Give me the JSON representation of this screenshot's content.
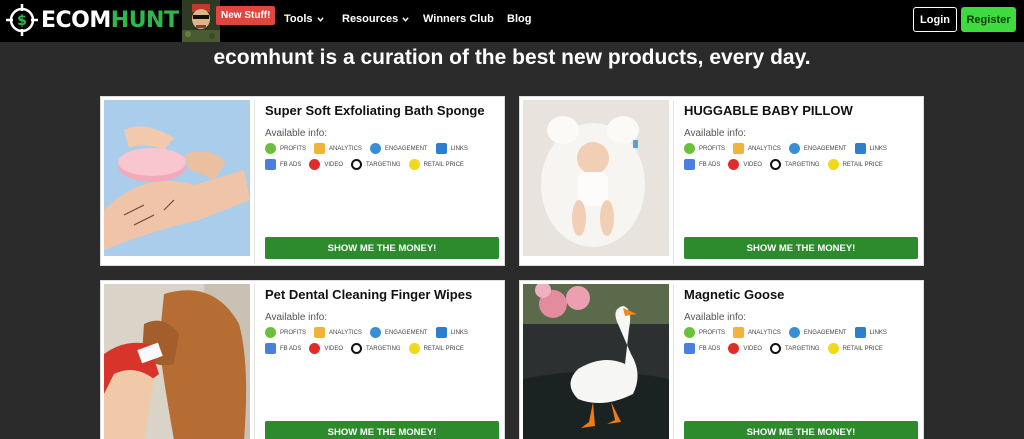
{
  "nav": {
    "logo_left": "ECOM",
    "logo_right": "HUNT",
    "new_badge": "New Stuff!",
    "tools": "Tools",
    "resources": "Resources",
    "winners": "Winners Club",
    "blog": "Blog",
    "login": "Login",
    "register": "Register"
  },
  "headline": "ecomhunt is a curation of the best new products, every day.",
  "common": {
    "available": "Available info:",
    "profits": "PROFITS",
    "analytics": "ANALYTICS",
    "engagement": "ENGAGEMENT",
    "links": "LINKS",
    "fbads": "FB ADS",
    "video": "VIDEO",
    "targeting": "TARGETING",
    "retail": "RETAIL PRICE",
    "button": "SHOW ME THE MONEY!"
  },
  "products": [
    {
      "title": "Super Soft Exfoliating Bath Sponge"
    },
    {
      "title": "HUGGABLE BABY PILLOW"
    },
    {
      "title": "Pet Dental Cleaning Finger Wipes"
    },
    {
      "title": "Magnetic Goose"
    }
  ],
  "colors": {
    "profits": "#6cbf3a",
    "analytics": "#f0b43a",
    "engagement": "#3a8fd4",
    "links": "#2e7ed0",
    "fbads": "#4a7fe0",
    "video": "#e02b2b",
    "targeting": "#111111",
    "retail": "#f2d91a",
    "button": "#2d8b2d"
  }
}
